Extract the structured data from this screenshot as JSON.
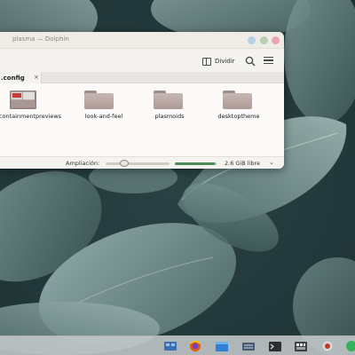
{
  "window": {
    "title": "plasma — Dolphin",
    "toolbar": {
      "split_label": "Dividir"
    },
    "tab": {
      "label": ".config",
      "close": "×"
    },
    "items": [
      {
        "label": "containmentpreviews"
      },
      {
        "label": "look-and-feel"
      },
      {
        "label": "plasmoids"
      },
      {
        "label": "desktoptheme"
      }
    ],
    "statusbar": {
      "zoom_label": "Ampliación:",
      "free_space": "2.6 GiB libre",
      "used_fraction": 0.95
    }
  },
  "taskbar": {
    "icons": [
      "window-switcher-icon",
      "firefox-icon",
      "dolphin-icon",
      "system-settings-icon",
      "konsole-icon",
      "discover-icon",
      "app-icon",
      "network-icon"
    ]
  },
  "colors": {
    "accent": "#4c8a58",
    "window_bg": "#f5f3ef",
    "folder": "#b9a8a4"
  }
}
